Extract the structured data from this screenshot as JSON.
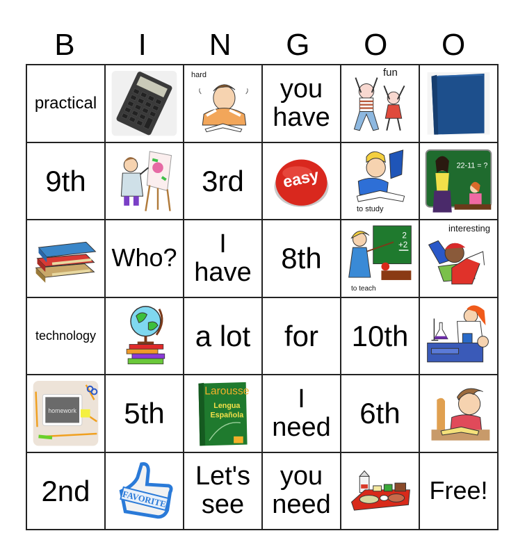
{
  "title_letters": [
    "B",
    "I",
    "N",
    "G",
    "O",
    "O"
  ],
  "rows": [
    [
      {
        "type": "text",
        "text": "practical",
        "size": "sm"
      },
      {
        "type": "image",
        "icon": "calculator-icon",
        "caption": ""
      },
      {
        "type": "image",
        "icon": "stressed-student-icon",
        "caption": "hard"
      },
      {
        "type": "text",
        "text": "you have",
        "lines": [
          "you",
          "have"
        ],
        "size": "lg"
      },
      {
        "type": "image",
        "icon": "jumping-kids-icon",
        "caption": "fun"
      },
      {
        "type": "image",
        "icon": "blue-binder-icon",
        "caption": ""
      }
    ],
    [
      {
        "type": "text",
        "text": "9th",
        "size": "xl"
      },
      {
        "type": "image",
        "icon": "painting-girl-icon",
        "caption": ""
      },
      {
        "type": "text",
        "text": "3rd",
        "size": "xl"
      },
      {
        "type": "image",
        "icon": "easy-button-icon",
        "caption": "easy"
      },
      {
        "type": "image",
        "icon": "studying-boy-icon",
        "caption": "to study"
      },
      {
        "type": "image",
        "icon": "teacher-chalkboard-icon",
        "caption": "22-11 = ?"
      }
    ],
    [
      {
        "type": "image",
        "icon": "book-stack-icon",
        "caption": ""
      },
      {
        "type": "text",
        "text": "Who?",
        "size": "md"
      },
      {
        "type": "text",
        "text": "I have",
        "lines": [
          "I",
          "have"
        ],
        "size": "lg"
      },
      {
        "type": "text",
        "text": "8th",
        "size": "xl"
      },
      {
        "type": "image",
        "icon": "teacher-pointing-icon",
        "caption": "to teach",
        "board": "2 +2"
      },
      {
        "type": "image",
        "icon": "reading-boy-icon",
        "caption": "interesting"
      }
    ],
    [
      {
        "type": "text",
        "text": "technology",
        "size": "xs"
      },
      {
        "type": "image",
        "icon": "globe-books-icon",
        "caption": ""
      },
      {
        "type": "text",
        "text": "a lot",
        "size": "xl"
      },
      {
        "type": "text",
        "text": "for",
        "size": "xl"
      },
      {
        "type": "text",
        "text": "10th",
        "size": "xl"
      },
      {
        "type": "image",
        "icon": "science-lab-icon",
        "caption": ""
      }
    ],
    [
      {
        "type": "image",
        "icon": "homework-tablet-icon",
        "caption": "homework"
      },
      {
        "type": "text",
        "text": "5th",
        "size": "xl"
      },
      {
        "type": "image",
        "icon": "spanish-dictionary-icon",
        "caption": "Larousse",
        "subcaption": "Lengua Española"
      },
      {
        "type": "text",
        "text": "I need",
        "lines": [
          "I",
          "need"
        ],
        "size": "lg"
      },
      {
        "type": "text",
        "text": "6th",
        "size": "xl"
      },
      {
        "type": "image",
        "icon": "bored-reader-icon",
        "caption": ""
      }
    ],
    [
      {
        "type": "text",
        "text": "2nd",
        "size": "xl"
      },
      {
        "type": "image",
        "icon": "favorite-thumbs-up-icon",
        "caption": "FAVORITE"
      },
      {
        "type": "text",
        "text": "Let's see",
        "lines": [
          "Let's",
          "see"
        ],
        "size": "lg"
      },
      {
        "type": "text",
        "text": "you need",
        "lines": [
          "you",
          "need"
        ],
        "size": "lg"
      },
      {
        "type": "image",
        "icon": "lunch-tray-icon",
        "caption": ""
      },
      {
        "type": "text",
        "text": "Free!",
        "size": "md"
      }
    ]
  ]
}
